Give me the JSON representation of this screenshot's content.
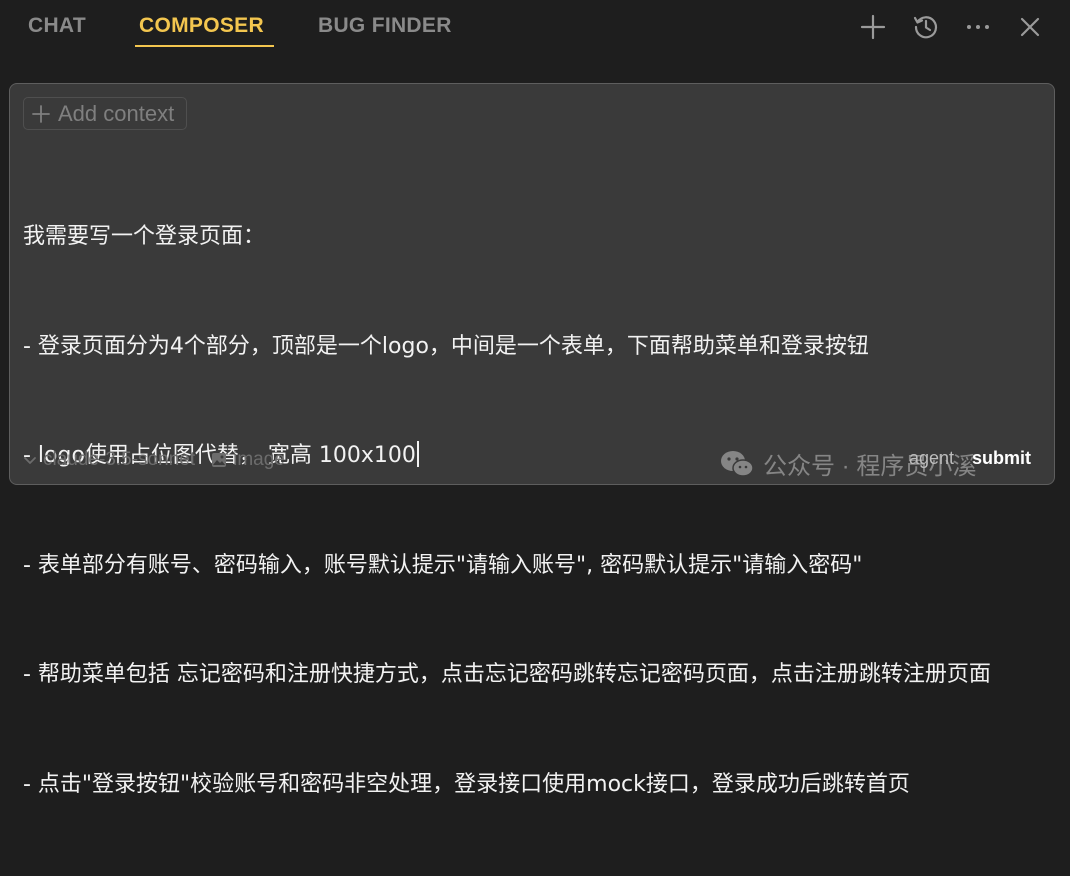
{
  "tabs": [
    {
      "label": "CHAT",
      "active": false
    },
    {
      "label": "COMPOSER",
      "active": true
    },
    {
      "label": "BUG FINDER",
      "active": false
    }
  ],
  "header_actions": [
    "plus-icon",
    "history-icon",
    "more-icon",
    "close-icon"
  ],
  "composer": {
    "add_context_label": "Add context",
    "prompt_lines": [
      "我需要写一个登录页面：",
      "- 登录页面分为4个部分，顶部是一个logo，中间是一个表单，下面帮助菜单和登录按钮",
      "- logo使用占位图代替， 宽高 100x100",
      "- 表单部分有账号、密码输入，账号默认提示\"请输入账号\", 密码默认提示\"请输入密码\"",
      "- 帮助菜单包括 忘记密码和注册快捷方式，点击忘记密码跳转忘记密码页面，点击注册跳转注册页面",
      "- 点击\"登录按钮\"校验账号和密码非空处理，登录接口使用mock接口，登录成功后跳转首页"
    ],
    "model": "claude-3.5-sonnet",
    "image_label": "image",
    "agent_label": "agent",
    "submit_label": "submit",
    "watermark": "公众号 · 程序员小溪"
  },
  "colors": {
    "background": "#1e1e1e",
    "panel": "#3a3a3a",
    "accent": "#f3c64f",
    "text": "#f2f2f2",
    "muted": "#6c6c6c"
  }
}
